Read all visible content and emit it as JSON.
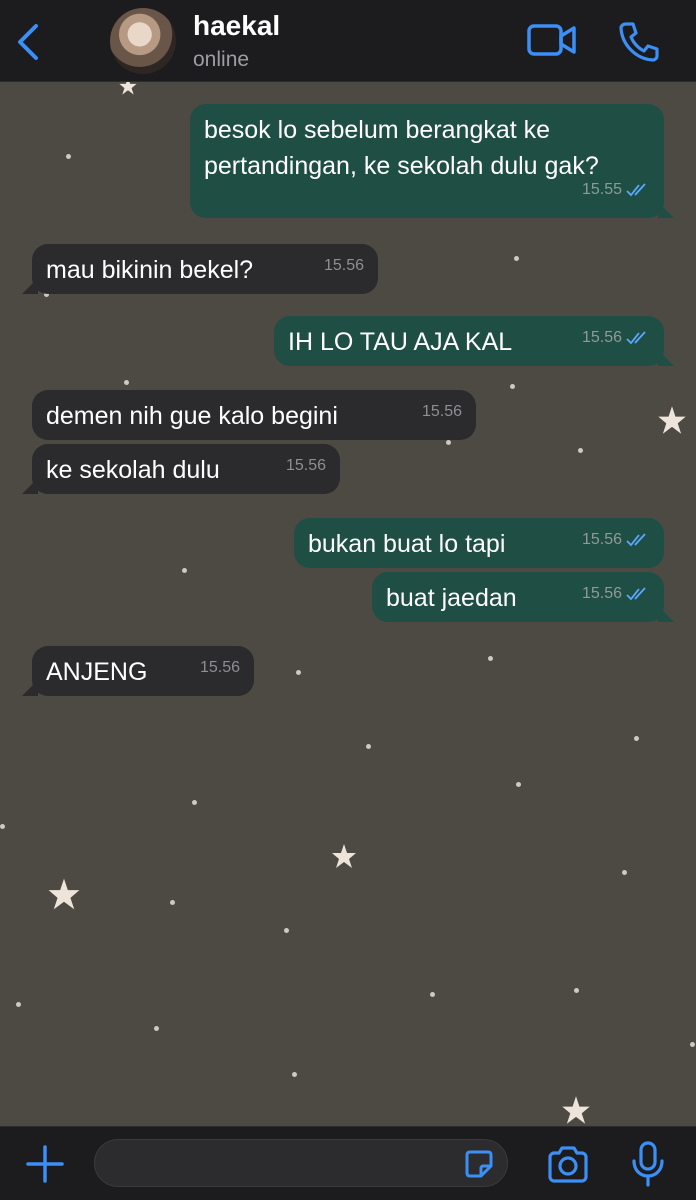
{
  "header": {
    "contact_name": "haekal",
    "status": "online",
    "accent_color": "#3b8ff6"
  },
  "messages": [
    {
      "direction": "outgoing",
      "text": "besok lo sebelum berangkat ke pertandingan, ke sekolah dulu gak?",
      "time": "15.55",
      "read": true
    },
    {
      "direction": "incoming",
      "text": "mau bikinin bekel?",
      "time": "15.56"
    },
    {
      "direction": "outgoing",
      "text": "IH LO TAU AJA KAL",
      "time": "15.56",
      "read": true
    },
    {
      "direction": "incoming",
      "text": "demen nih gue kalo begini",
      "time": "15.56"
    },
    {
      "direction": "incoming",
      "text": "ke sekolah dulu",
      "time": "15.56"
    },
    {
      "direction": "outgoing",
      "text": "bukan buat lo tapi",
      "time": "15.56",
      "read": true
    },
    {
      "direction": "outgoing",
      "text": "buat jaedan",
      "time": "15.56",
      "read": true
    },
    {
      "direction": "incoming",
      "text": "ANJENG",
      "time": "15.56"
    }
  ],
  "footer": {
    "input_value": ""
  },
  "icons": {
    "back": "chevron-left-icon",
    "video": "video-camera-icon",
    "call": "phone-icon",
    "plus": "plus-icon",
    "sticker": "sticker-icon",
    "camera": "camera-icon",
    "mic": "microphone-icon"
  }
}
